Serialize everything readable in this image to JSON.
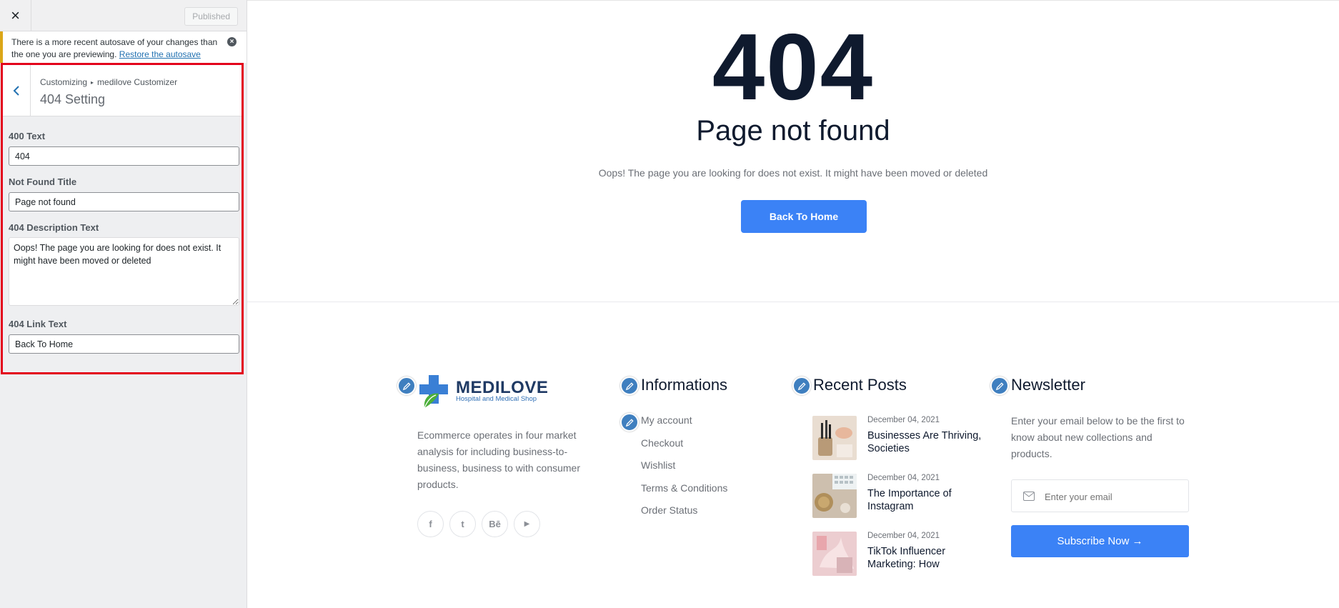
{
  "topbar": {
    "close_icon": "×",
    "published_label": "Published"
  },
  "notice": {
    "text": "There is a more recent autosave of your changes than the one you are previewing.",
    "link": "Restore the autosave",
    "accent_color": "#dba617"
  },
  "section": {
    "breadcrumb_root": "Customizing",
    "breadcrumb_sep": "▸",
    "breadcrumb_parent": "medilove Customizer",
    "title": "404 Setting",
    "highlight_color": "#e3001b"
  },
  "fields": {
    "text_label": "400 Text",
    "text_value": "404",
    "title_label": "Not Found Title",
    "title_value": "Page not found",
    "desc_label": "404 Description Text",
    "desc_value": "Oops! The page you are looking for does not exist. It might have been moved or deleted",
    "link_label": "404 Link Text",
    "link_value": "Back To Home"
  },
  "preview": {
    "big_number": "404",
    "title": "Page not found",
    "description": "Oops! The page you are looking for does not exist. It might have been moved or deleted",
    "button": "Back To Home",
    "accent_color": "#3b82f6"
  },
  "footer": {
    "brand_name": "MEDILOVE",
    "brand_tagline": "Hospital and Medical Shop",
    "about": "Ecommerce operates in four market analysis for including business-to-business, business to with consumer products.",
    "socials": [
      {
        "icon": "facebook-icon",
        "glyph": "f"
      },
      {
        "icon": "twitter-icon",
        "glyph": "t"
      },
      {
        "icon": "behance-icon",
        "glyph": "Bē"
      },
      {
        "icon": "youtube-icon",
        "glyph": "▶"
      }
    ],
    "info_title": "Informations",
    "info_links": [
      "My account",
      "Checkout",
      "Wishlist",
      "Terms & Conditions",
      "Order Status"
    ],
    "posts_title": "Recent Posts",
    "posts": [
      {
        "date": "December 04, 2021",
        "title": "Businesses Are Thriving, Societies"
      },
      {
        "date": "December 04, 2021",
        "title": "The Importance of Instagram"
      },
      {
        "date": "December 04, 2021",
        "title": "TikTok Influencer Marketing: How"
      }
    ],
    "newsletter_title": "Newsletter",
    "newsletter_desc": "Enter your email below to be the first to know about new collections and products.",
    "email_placeholder": "Enter your email",
    "subscribe_label": "Subscribe Now →"
  }
}
